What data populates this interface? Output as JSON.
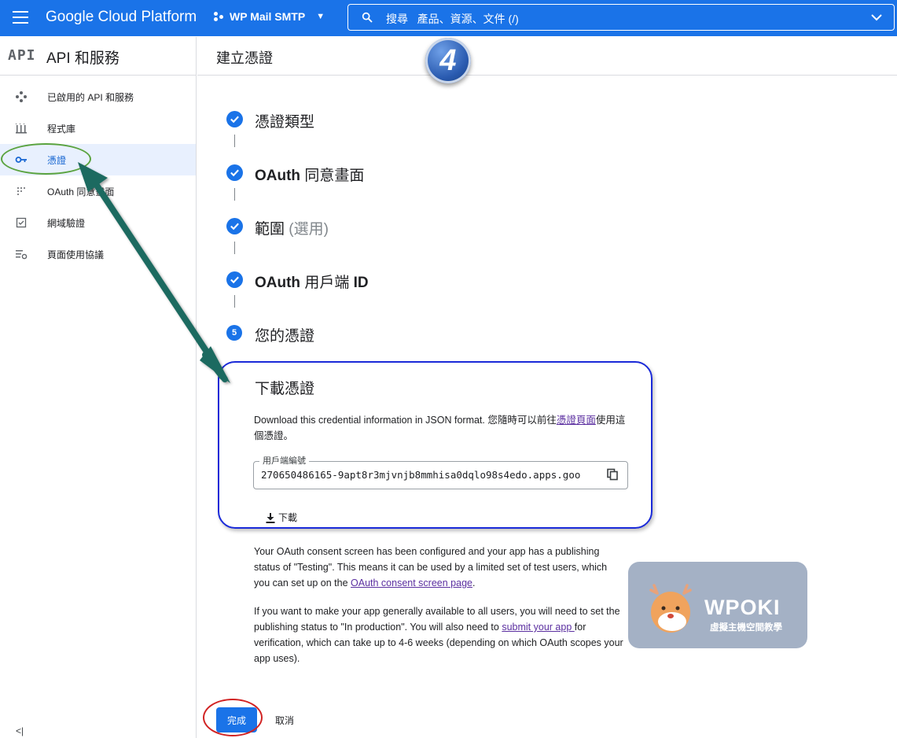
{
  "topbar": {
    "brand": "Google Cloud Platform",
    "project": "WP Mail SMTP",
    "search_prefix": "搜尋",
    "search_hint": "產品、資源、文件 (/)"
  },
  "sidebar": {
    "logo": "API",
    "title": "API 和服務",
    "items": [
      {
        "label": "已啟用的 API 和服務",
        "icon": "dashboard-icon"
      },
      {
        "label": "程式庫",
        "icon": "library-icon"
      },
      {
        "label": "憑證",
        "icon": "key-icon",
        "active": true
      },
      {
        "label": "OAuth 同意畫面",
        "icon": "consent-icon"
      },
      {
        "label": "網域驗證",
        "icon": "checkbox-icon"
      },
      {
        "label": "頁面使用協議",
        "icon": "settings-list-icon"
      }
    ],
    "collapse_label": "<|"
  },
  "main": {
    "title": "建立憑證",
    "annotation_number": "4",
    "steps": [
      {
        "label": "憑證類型",
        "status": "done"
      },
      {
        "label_bold": "OAuth",
        "label": " 同意畫面",
        "status": "done"
      },
      {
        "label": "範圍",
        "label_muted": " (選用)",
        "status": "done"
      },
      {
        "label_bold": "OAuth",
        "label": " 用戶端 ",
        "label_bold2": "ID",
        "status": "done"
      },
      {
        "number": "5",
        "label": "您的憑證",
        "status": "current"
      }
    ],
    "card": {
      "title": "下載憑證",
      "desc_before": "Download this credential information in JSON format. 您隨時可以前往",
      "desc_link": "憑證頁面",
      "desc_after": "使用這個憑證。",
      "field_label": "用戶端編號",
      "field_value": "270650486165-9apt8r3mjvnjb8mmhisa0dqlo98s4edo.apps.goo",
      "download_label": "下載"
    },
    "para1_before": "Your OAuth consent screen has been configured and your app has a publishing status of \"Testing\". This means it can be used by a limited set of test users, which you can set up on the ",
    "para1_link": "OAuth consent screen page",
    "para1_after": ".",
    "para2_before": "If you want to make your app generally available to all users, you will need to set the publishing status to \"In production\". You will also need to ",
    "para2_link": "submit your app ",
    "para2_after": "for verification, which can take up to 4-6 weeks (depending on which OAuth scopes your app uses).",
    "done_label": "完成",
    "cancel_label": "取消"
  },
  "watermark": {
    "name": "WPOKI",
    "subtitle": "虛擬主機空間教學"
  },
  "colors": {
    "primary": "#1a73e8",
    "link": "#5b2fa0",
    "annotation_green": "#5aa33f",
    "annotation_red": "#d12323",
    "annotation_blue": "#1a2ad8",
    "arrow": "#1f6b60"
  }
}
